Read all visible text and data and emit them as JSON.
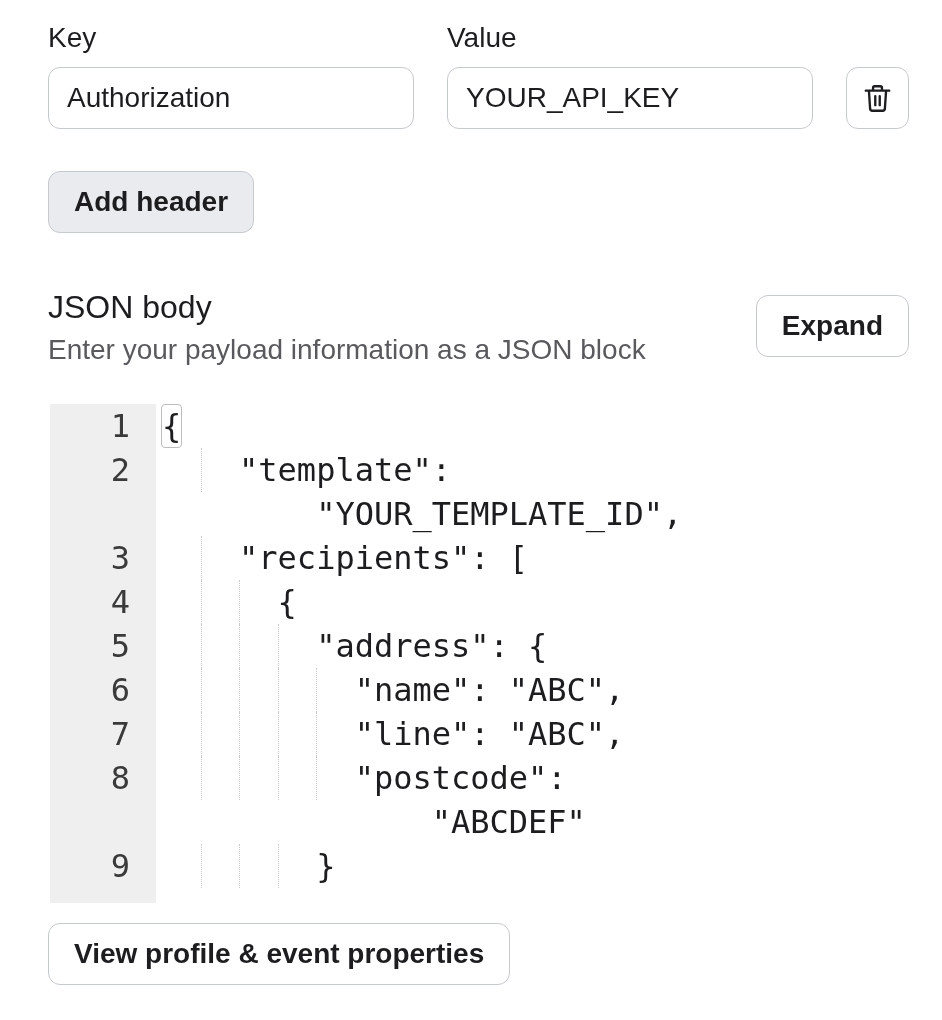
{
  "headers": [
    {
      "key_label": "Key",
      "key": "Authorization",
      "value_label": "Value",
      "value": "YOUR_API_KEY"
    }
  ],
  "add_header_button": "Add header",
  "json_body": {
    "title": "JSON body",
    "description": "Enter your payload information as a JSON block",
    "expand_button": "Expand",
    "editor": {
      "lines": [
        {
          "number": "1",
          "text": "{",
          "bracket_match": true
        },
        {
          "number": "2",
          "text": "    \"template\": \"YOUR_TEMPLATE_ID\",",
          "bracket_match": false
        },
        {
          "number": "3",
          "text": "    \"recipients\": [",
          "bracket_match": false
        },
        {
          "number": "4",
          "text": "      {",
          "bracket_match": false
        },
        {
          "number": "5",
          "text": "        \"address\": {",
          "bracket_match": false
        },
        {
          "number": "6",
          "text": "          \"name\": \"ABC\",",
          "bracket_match": false
        },
        {
          "number": "7",
          "text": "          \"line\": \"ABC\",",
          "bracket_match": false
        },
        {
          "number": "8",
          "text": "          \"postcode\": \"ABCDEF\"",
          "bracket_match": false
        },
        {
          "number": "9",
          "text": "        }",
          "bracket_match": false
        }
      ]
    }
  },
  "view_properties_button": "View profile & event properties"
}
